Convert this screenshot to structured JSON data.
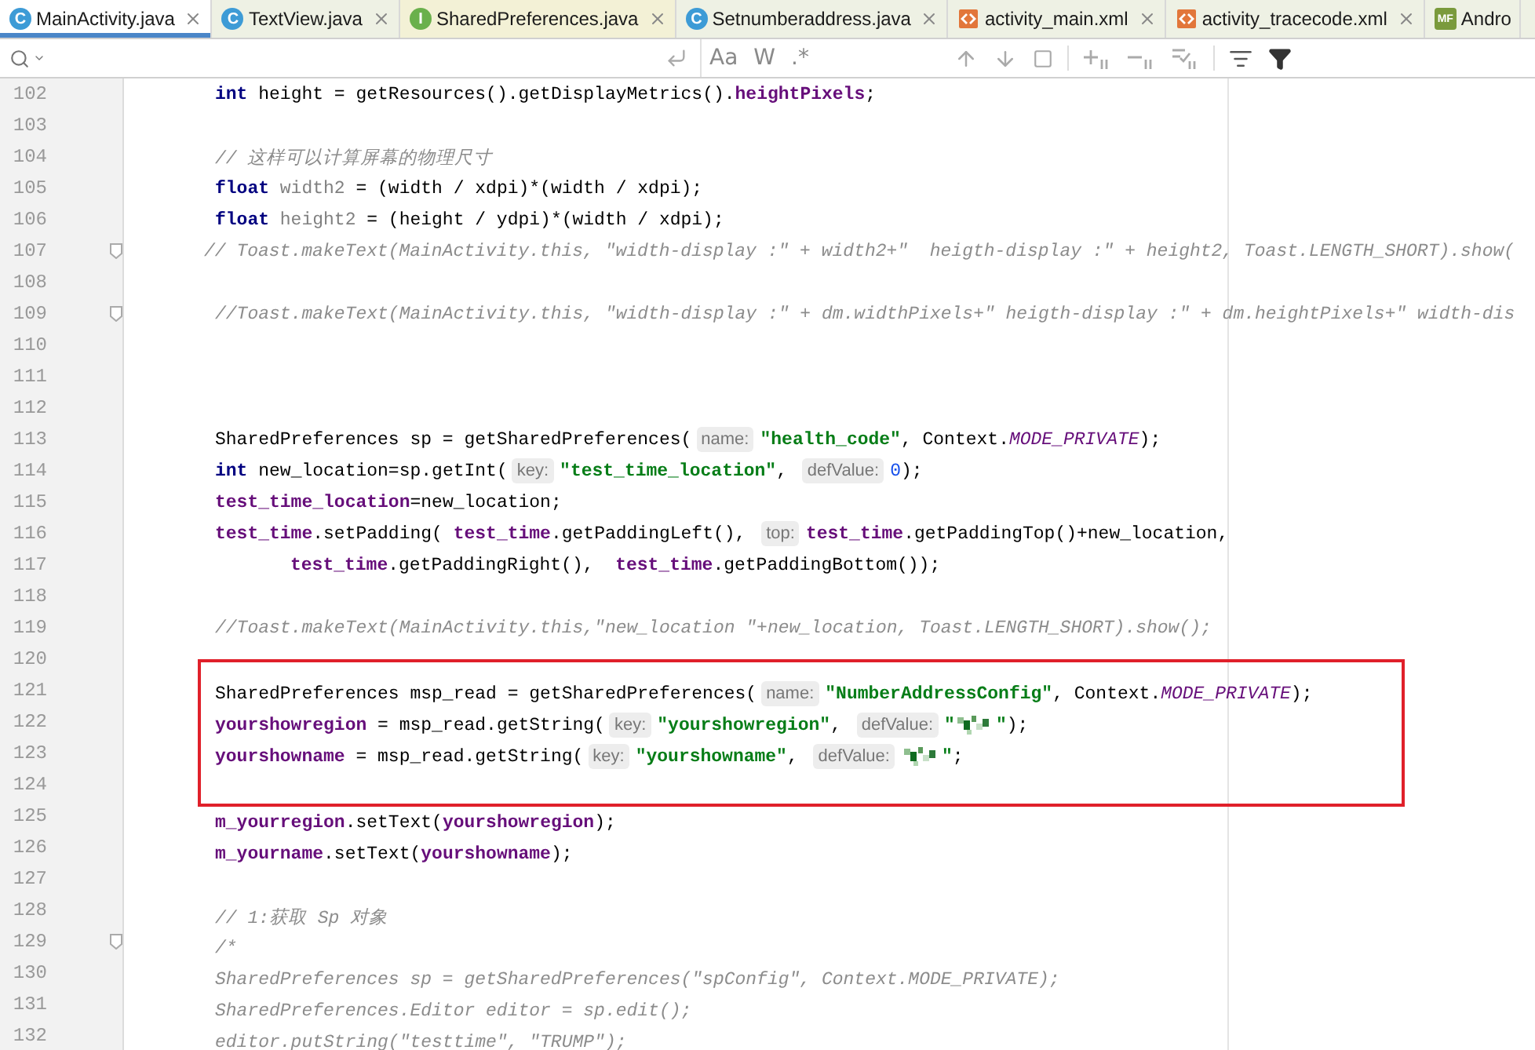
{
  "tabs": [
    {
      "label": "MainActivity.java",
      "kind": "java-class",
      "badge": "C",
      "color": "#ffffff",
      "selected": true,
      "closable": true
    },
    {
      "label": "TextView.java",
      "kind": "java-class",
      "badge": "C",
      "color": "#eef1e4",
      "selected": false,
      "closable": true
    },
    {
      "label": "SharedPreferences.java",
      "kind": "java-interface",
      "badge": "I",
      "color": "#f3f1d6",
      "selected": false,
      "closable": true
    },
    {
      "label": "Setnumberaddress.java",
      "kind": "java-class",
      "badge": "C",
      "color": "#eef1e4",
      "selected": false,
      "closable": true
    },
    {
      "label": "activity_main.xml",
      "kind": "xml",
      "color": "#eef1e4",
      "selected": false,
      "closable": true
    },
    {
      "label": "activity_tracecode.xml",
      "kind": "xml",
      "color": "#eef1e4",
      "selected": false,
      "closable": true
    },
    {
      "label": "Andro",
      "kind": "manifest",
      "badge": "MF",
      "color": "#eef1e4",
      "selected": false,
      "closable": false
    }
  ],
  "search": {
    "options": [
      "Aa",
      "W",
      ".*"
    ]
  },
  "lines": [
    {
      "number": "102",
      "kind": "body",
      "tokens": [
        {
          "kind": "keyword",
          "text": "int"
        },
        {
          "kind": "plain",
          "text": " height = getResources().getDisplayMetrics()."
        },
        {
          "kind": "field",
          "text": "heightPixels"
        },
        {
          "kind": "plain",
          "text": ";"
        }
      ]
    },
    {
      "number": "103"
    },
    {
      "number": "104",
      "kind": "body",
      "tokens": [
        {
          "kind": "comment",
          "text": "// 这样可以计算屏幕的物理尺寸"
        }
      ]
    },
    {
      "number": "105",
      "kind": "body",
      "tokens": [
        {
          "kind": "keyword",
          "text": "float"
        },
        {
          "kind": "unused",
          "text": "width2"
        },
        {
          "kind": "plain",
          "text": " = (width / xdpi)*(width / xdpi);"
        }
      ]
    },
    {
      "number": "106",
      "kind": "body",
      "tokens": [
        {
          "kind": "keyword",
          "text": "float"
        },
        {
          "kind": "unused",
          "text": "height2"
        },
        {
          "kind": "plain",
          "text": " = (height / ydpi)*(width / xdpi);"
        }
      ]
    },
    {
      "number": "107",
      "fold": true,
      "kind": "outdent",
      "tokens": [
        {
          "kind": "comment",
          "text": "// Toast.makeText(MainActivity.this, \"width-display :\" + width2+\"  heigth-display :\" + height2, Toast.LENGTH_SHORT).show("
        }
      ]
    },
    {
      "number": "108"
    },
    {
      "number": "109",
      "fold": true,
      "kind": "body",
      "tokens": [
        {
          "kind": "comment",
          "text": "//Toast.makeText(MainActivity.this, \"width-display :\" + dm.widthPixels+\" heigth-display :\" + dm.heightPixels+\" width-dis"
        }
      ]
    },
    {
      "number": "110"
    },
    {
      "number": "111"
    },
    {
      "number": "112"
    },
    {
      "number": "113",
      "kind": "body",
      "tokens": [
        {
          "kind": "plain",
          "text": "SharedPreferences sp = getSharedPreferences("
        },
        {
          "kind": "hint",
          "text": "name:"
        },
        {
          "kind": "string",
          "text": "\"health_code\""
        },
        {
          "kind": "plain",
          "text": ", Context."
        },
        {
          "kind": "constant",
          "text": "MODE_PRIVATE"
        },
        {
          "kind": "plain",
          "text": ");"
        }
      ]
    },
    {
      "number": "114",
      "kind": "body",
      "tokens": [
        {
          "kind": "keyword",
          "text": "int"
        },
        {
          "kind": "plain",
          "text": " new_location=sp.getInt("
        },
        {
          "kind": "hint",
          "text": "key:"
        },
        {
          "kind": "string",
          "text": "\"test_time_location\""
        },
        {
          "kind": "plain",
          "text": ", "
        },
        {
          "kind": "hint",
          "text": "defValue:"
        },
        {
          "kind": "number",
          "text": "0"
        },
        {
          "kind": "plain",
          "text": ");"
        }
      ]
    },
    {
      "number": "115",
      "kind": "body",
      "tokens": [
        {
          "kind": "field",
          "text": "test_time_location"
        },
        {
          "kind": "plain",
          "text": "=new_location;"
        }
      ]
    },
    {
      "number": "116",
      "kind": "body",
      "tokens": [
        {
          "kind": "field",
          "text": "test_time"
        },
        {
          "kind": "plain",
          "text": ".setPadding( "
        },
        {
          "kind": "field",
          "text": "test_time"
        },
        {
          "kind": "plain",
          "text": ".getPaddingLeft(), "
        },
        {
          "kind": "hint",
          "text": "top:"
        },
        {
          "kind": "field",
          "text": "test_time"
        },
        {
          "kind": "plain",
          "text": ".getPaddingTop()+new_location,"
        }
      ]
    },
    {
      "number": "117",
      "kind": "wrap",
      "tokens": [
        {
          "kind": "field",
          "text": "test_time"
        },
        {
          "kind": "plain",
          "text": ".getPaddingRight(),  "
        },
        {
          "kind": "field",
          "text": "test_time"
        },
        {
          "kind": "plain",
          "text": ".getPaddingBottom());"
        }
      ]
    },
    {
      "number": "118"
    },
    {
      "number": "119",
      "kind": "body",
      "tokens": [
        {
          "kind": "comment",
          "text": "//Toast.makeText(MainActivity.this,\"new_location \"+new_location, Toast.LENGTH_SHORT).show();"
        }
      ]
    },
    {
      "number": "120"
    },
    {
      "number": "121",
      "boxed": true,
      "kind": "body",
      "tokens": [
        {
          "kind": "plain",
          "text": "SharedPreferences msp_read = getSharedPreferences("
        },
        {
          "kind": "hint",
          "text": "name:"
        },
        {
          "kind": "string",
          "text": "\"NumberAddressConfig\""
        },
        {
          "kind": "plain",
          "text": ", Context."
        },
        {
          "kind": "constant",
          "text": "MODE_PRIVATE"
        },
        {
          "kind": "plain",
          "text": ");"
        }
      ]
    },
    {
      "number": "122",
      "boxed": true,
      "kind": "body",
      "tokens": [
        {
          "kind": "field",
          "text": "yourshowregion"
        },
        {
          "kind": "plain",
          "text": " = msp_read.getString("
        },
        {
          "kind": "hint",
          "text": "key:"
        },
        {
          "kind": "string",
          "text": "\"yourshowregion\""
        },
        {
          "kind": "plain",
          "text": ", "
        },
        {
          "kind": "hint",
          "text": "defValue:"
        },
        {
          "kind": "string",
          "text": "\""
        },
        {
          "kind": "redacted"
        },
        {
          "kind": "string",
          "text": "\""
        },
        {
          "kind": "plain",
          "text": ");"
        }
      ]
    },
    {
      "number": "123",
      "boxed": true,
      "kind": "body",
      "tokens": [
        {
          "kind": "field",
          "text": "yourshowname"
        },
        {
          "kind": "plain",
          "text": " = msp_read.getString("
        },
        {
          "kind": "hint",
          "text": "key:"
        },
        {
          "kind": "string",
          "text": "\"yourshowname\""
        },
        {
          "kind": "plain",
          "text": ", "
        },
        {
          "kind": "hint",
          "text": "defValue:"
        },
        {
          "kind": "redacted"
        },
        {
          "kind": "string",
          "text": "\""
        },
        {
          "kind": "plain",
          "text": ";"
        }
      ]
    },
    {
      "number": "124",
      "boxed": true
    },
    {
      "number": "125",
      "kind": "body",
      "tokens": [
        {
          "kind": "field",
          "text": "m_yourregion"
        },
        {
          "kind": "plain",
          "text": ".setText("
        },
        {
          "kind": "field",
          "text": "yourshowregion"
        },
        {
          "kind": "plain",
          "text": ");"
        }
      ]
    },
    {
      "number": "126",
      "kind": "body",
      "tokens": [
        {
          "kind": "field",
          "text": "m_yourname"
        },
        {
          "kind": "plain",
          "text": ".setText("
        },
        {
          "kind": "field",
          "text": "yourshowname"
        },
        {
          "kind": "plain",
          "text": ");"
        }
      ]
    },
    {
      "number": "127"
    },
    {
      "number": "128",
      "kind": "body",
      "tokens": [
        {
          "kind": "comment",
          "text": "// 1:获取 Sp 对象"
        }
      ]
    },
    {
      "number": "129",
      "fold": true,
      "kind": "body",
      "tokens": [
        {
          "kind": "comment",
          "text": "/*"
        }
      ]
    },
    {
      "number": "130",
      "kind": "body",
      "tokens": [
        {
          "kind": "comment",
          "text": "SharedPreferences sp = getSharedPreferences(\"spConfig\", Context.MODE_PRIVATE);"
        }
      ]
    },
    {
      "number": "131",
      "kind": "body",
      "tokens": [
        {
          "kind": "comment",
          "text": "SharedPreferences.Editor editor = sp.edit();"
        }
      ]
    },
    {
      "number": "132",
      "kind": "body",
      "tokens": [
        {
          "kind": "comment",
          "text": "editor.putString(\"testtime\", \"TRUMP\");"
        }
      ]
    }
  ]
}
